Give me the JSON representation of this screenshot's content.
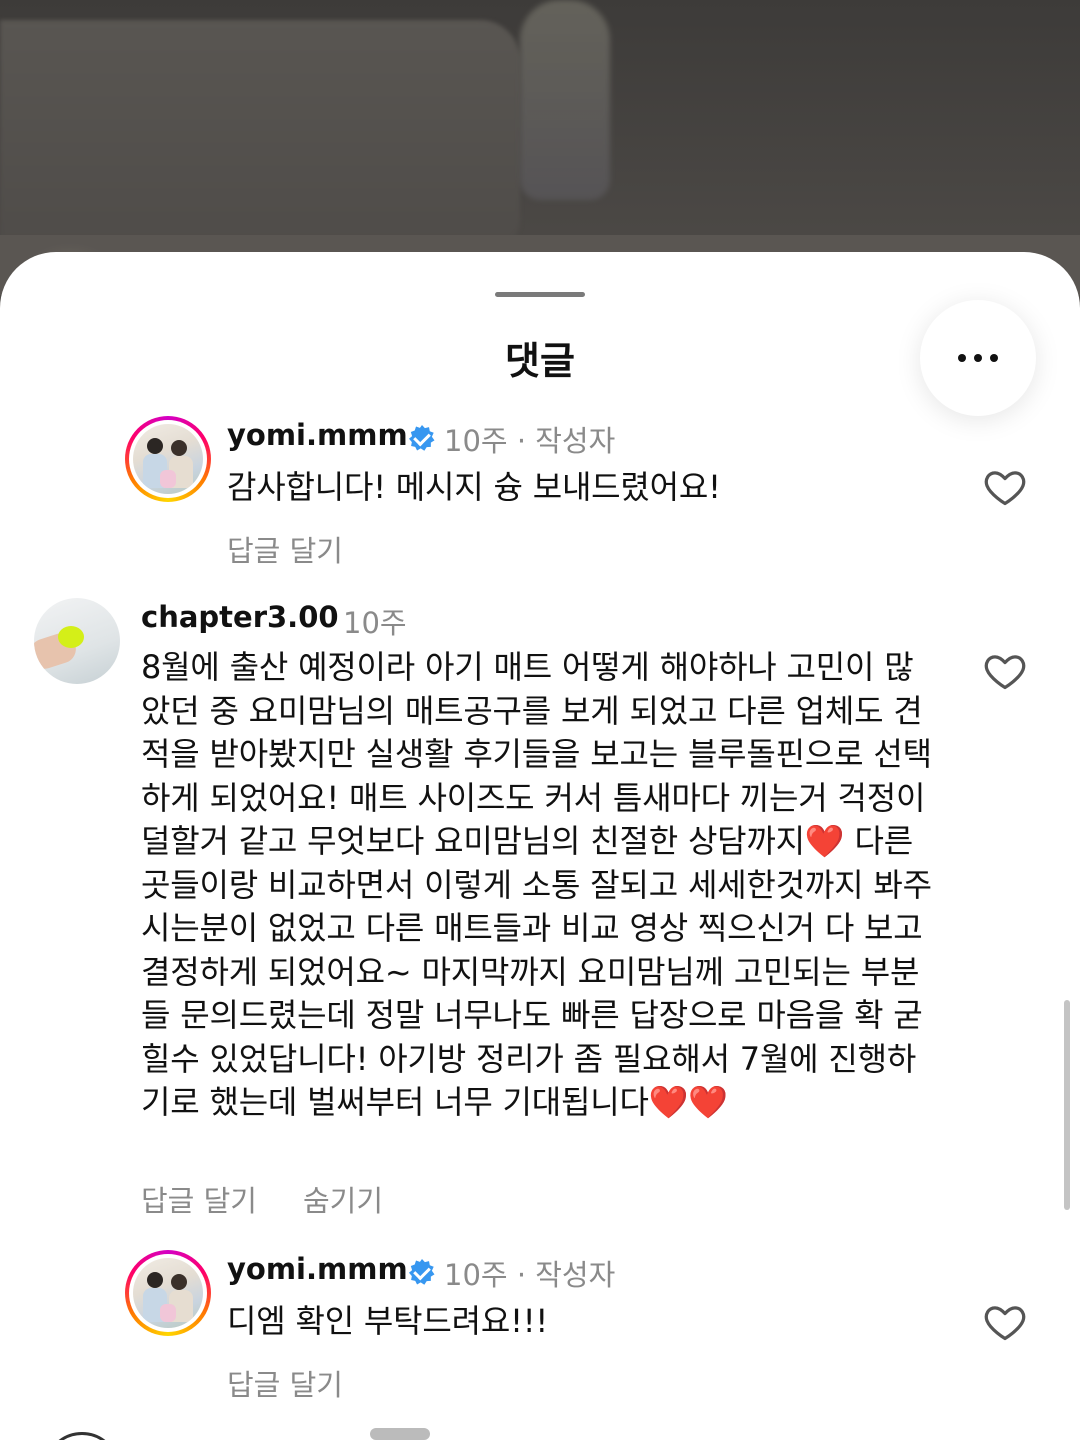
{
  "sheet": {
    "title": "댓글",
    "more_icon": "more-horizontal-icon"
  },
  "comments": [
    {
      "username": "yomi.mmm",
      "verified": true,
      "time": "10주",
      "author_tag": "· 작성자",
      "text": "감사합니다! 메시지 슝 보내드렸어요!",
      "reply_label": "답글 달기",
      "like_icon": "heart-outline-icon"
    },
    {
      "username": "chapter3.00",
      "verified": false,
      "time": "10주",
      "text": "8월에 출산 예정이라 아기 매트 어떻게 해야하나 고민이 많았던 중 요미맘님의 매트공구를 보게 되었고 다른 업체도 견적을 받아봤지만 실생활 후기들을 보고는 블루돌핀으로 선택하게 되었어요! 매트 사이즈도 커서 틈새마다 끼는거 걱정이 덜할거 같고 무엇보다 요미맘님의 친절한 상담까지❤️ 다른곳들이랑 비교하면서 이렇게 소통 잘되고 세세한것까지 봐주시는분이 없었고 다른 매트들과 비교 영상 찍으신거 다 보고 결정하게 되었어요~ 마지막까지 요미맘님께 고민되는 부분들 문의드렸는데 정말 너무나도 빠른 답장으로 마음을 확 굳힐수 있었답니다! 아기방 정리가 좀 필요해서 7월에 진행하기로 했는데 벌써부터 너무 기대됩니다❤️❤️",
      "reply_label": "답글 달기",
      "hide_label": "숨기기",
      "like_icon": "heart-outline-icon"
    },
    {
      "username": "yomi.mmm",
      "verified": true,
      "time": "10주",
      "author_tag": "· 작성자",
      "text": "디엠 확인 부탁드려요!!!",
      "reply_label": "답글 달기",
      "like_icon": "heart-outline-icon"
    }
  ]
}
